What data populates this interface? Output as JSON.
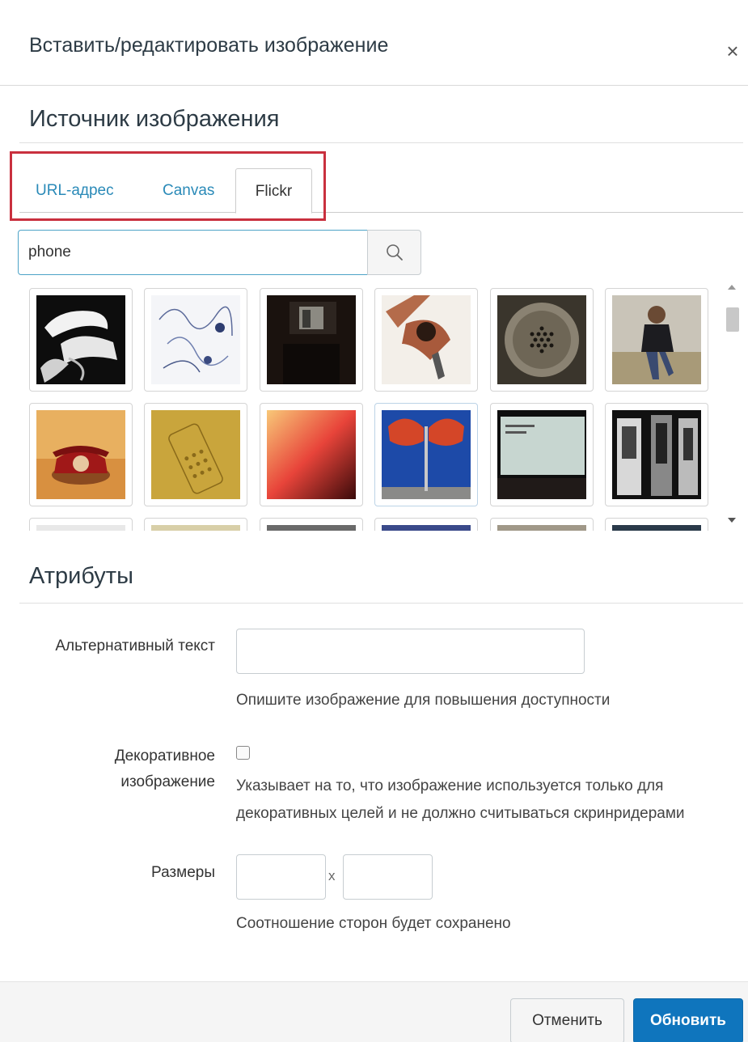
{
  "dialog": {
    "title": "Вставить/редактировать изображение",
    "close_symbol": "×"
  },
  "source": {
    "heading": "Источник изображения",
    "tabs": [
      {
        "label": "URL-адрес",
        "active": false
      },
      {
        "label": "Canvas",
        "active": false
      },
      {
        "label": "Flickr",
        "active": true
      }
    ],
    "highlight_color": "#c9303e",
    "search": {
      "value": "phone",
      "placeholder": "",
      "icon": "search-icon"
    },
    "thumbnails": [
      {
        "row": 1,
        "col": 1,
        "icon": "white-desk-phone-thumbnail"
      },
      {
        "row": 1,
        "col": 2,
        "icon": "earphones-cable-thumbnail"
      },
      {
        "row": 1,
        "col": 3,
        "icon": "dark-phone-booth-thumbnail"
      },
      {
        "row": 1,
        "col": 4,
        "icon": "copper-wall-phone-thumbnail"
      },
      {
        "row": 1,
        "col": 5,
        "icon": "speaker-grille-thumbnail"
      },
      {
        "row": 1,
        "col": 6,
        "icon": "woman-on-phone-thumbnail"
      },
      {
        "row": 2,
        "col": 1,
        "icon": "red-rotary-phone-thumbnail"
      },
      {
        "row": 2,
        "col": 2,
        "icon": "paper-phone-sketch-thumbnail"
      },
      {
        "row": 2,
        "col": 3,
        "icon": "red-gradient-thumbnail"
      },
      {
        "row": 2,
        "col": 4,
        "icon": "red-receiver-on-blue-thumbnail"
      },
      {
        "row": 2,
        "col": 5,
        "icon": "phone-screen-text-thumbnail"
      },
      {
        "row": 2,
        "col": 6,
        "icon": "black-white-booths-thumbnail"
      }
    ]
  },
  "attributes": {
    "heading": "Атрибуты",
    "alt_text": {
      "label": "Альтернативный текст",
      "value": "",
      "help": "Опишите изображение для повышения доступности"
    },
    "decorative": {
      "label_line1": "Декоративное",
      "label_line2": "изображение",
      "checked": false,
      "help_line1": "Указывает на то, что изображение используется только для",
      "help_line2": "декоративных целей и не должно считываться скринридерами"
    },
    "dimensions": {
      "label": "Размеры",
      "width": "",
      "height": "",
      "separator": "x",
      "help": "Соотношение сторон будет сохранено"
    }
  },
  "footer": {
    "cancel_label": "Отменить",
    "update_label": "Обновить"
  },
  "colors": {
    "link": "#2a8ab8",
    "primary": "#0f75bd",
    "focus": "#4da3c7"
  }
}
